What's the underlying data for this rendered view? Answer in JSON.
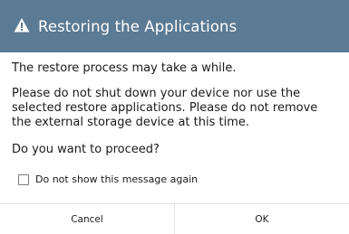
{
  "dialog": {
    "title": "Restoring the Applications",
    "title_icon": "warning-icon",
    "messages": [
      "The restore process may take a while.",
      "Please do not shut down your device nor use the selected restore applications. Please do not remove the external storage device at this time.",
      "Do you want to proceed?"
    ],
    "checkbox": {
      "label": "Do not show this message again",
      "checked": false
    },
    "buttons": {
      "cancel_label": "Cancel",
      "ok_label": "OK"
    }
  },
  "colors": {
    "title_bar": "#5b7a93",
    "title_text": "#ffffff",
    "body_text": "#1a1a1a",
    "divider": "#e2e2e2"
  }
}
